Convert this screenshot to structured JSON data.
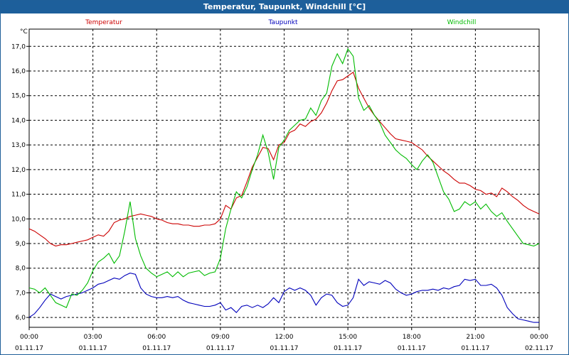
{
  "window": {
    "title": "Temperatur, Taupunkt, Windchill [°C]"
  },
  "chart_data": {
    "type": "line",
    "title": "Temperatur, Taupunkt, Windchill [°C]",
    "ylabel": "°C",
    "ylim": [
      5.6,
      17.7
    ],
    "xlim": [
      "01.11.17 00:00",
      "02.11.17 00:00"
    ],
    "grid": true,
    "legend_placement": "top",
    "y_ticks": [
      "6,0",
      "7,0",
      "8,0",
      "9,0",
      "10,0",
      "11,0",
      "12,0",
      "13,0",
      "14,0",
      "15,0",
      "16,0",
      "17,0"
    ],
    "x_ticks": [
      {
        "time": "00:00",
        "date": "01.11.17"
      },
      {
        "time": "03:00",
        "date": "01.11.17"
      },
      {
        "time": "06:00",
        "date": "01.11.17"
      },
      {
        "time": "09:00",
        "date": "01.11.17"
      },
      {
        "time": "12:00",
        "date": "01.11.17"
      },
      {
        "time": "15:00",
        "date": "01.11.17"
      },
      {
        "time": "18:00",
        "date": "01.11.17"
      },
      {
        "time": "21:00",
        "date": "01.11.17"
      },
      {
        "time": "00:00",
        "date": "02.11.17"
      }
    ],
    "series": [
      {
        "name": "Temperatur",
        "color": "#cc0000",
        "points": [
          [
            0,
            9.6
          ],
          [
            0.25,
            9.5
          ],
          [
            0.5,
            9.35
          ],
          [
            0.75,
            9.2
          ],
          [
            1,
            9.0
          ],
          [
            1.25,
            8.9
          ],
          [
            1.5,
            8.95
          ],
          [
            1.75,
            8.95
          ],
          [
            2,
            9.0
          ],
          [
            2.25,
            9.05
          ],
          [
            2.5,
            9.1
          ],
          [
            2.75,
            9.15
          ],
          [
            3,
            9.25
          ],
          [
            3.25,
            9.35
          ],
          [
            3.5,
            9.3
          ],
          [
            3.75,
            9.5
          ],
          [
            4,
            9.85
          ],
          [
            4.25,
            9.95
          ],
          [
            4.5,
            10.0
          ],
          [
            4.75,
            10.1
          ],
          [
            5,
            10.15
          ],
          [
            5.25,
            10.2
          ],
          [
            5.5,
            10.15
          ],
          [
            5.75,
            10.1
          ],
          [
            6,
            10.0
          ],
          [
            6.25,
            9.95
          ],
          [
            6.5,
            9.85
          ],
          [
            6.75,
            9.8
          ],
          [
            7,
            9.8
          ],
          [
            7.25,
            9.75
          ],
          [
            7.5,
            9.75
          ],
          [
            7.75,
            9.7
          ],
          [
            8,
            9.7
          ],
          [
            8.25,
            9.75
          ],
          [
            8.5,
            9.75
          ],
          [
            8.75,
            9.8
          ],
          [
            9,
            10.0
          ],
          [
            9.25,
            10.55
          ],
          [
            9.5,
            10.4
          ],
          [
            9.75,
            10.85
          ],
          [
            10,
            10.95
          ],
          [
            10.25,
            11.5
          ],
          [
            10.5,
            12.1
          ],
          [
            10.75,
            12.5
          ],
          [
            11,
            12.9
          ],
          [
            11.25,
            12.85
          ],
          [
            11.5,
            12.4
          ],
          [
            11.75,
            13.0
          ],
          [
            12,
            13.1
          ],
          [
            12.25,
            13.5
          ],
          [
            12.5,
            13.6
          ],
          [
            12.75,
            13.85
          ],
          [
            13,
            13.75
          ],
          [
            13.25,
            13.95
          ],
          [
            13.5,
            14.05
          ],
          [
            13.75,
            14.3
          ],
          [
            14,
            14.7
          ],
          [
            14.25,
            15.2
          ],
          [
            14.5,
            15.6
          ],
          [
            14.75,
            15.65
          ],
          [
            15,
            15.8
          ],
          [
            15.25,
            15.95
          ],
          [
            15.5,
            15.3
          ],
          [
            15.75,
            14.9
          ],
          [
            16,
            14.5
          ],
          [
            16.25,
            14.2
          ],
          [
            16.5,
            13.95
          ],
          [
            16.75,
            13.7
          ],
          [
            17,
            13.45
          ],
          [
            17.25,
            13.25
          ],
          [
            17.5,
            13.2
          ],
          [
            17.75,
            13.15
          ],
          [
            18,
            13.1
          ],
          [
            18.25,
            12.95
          ],
          [
            18.5,
            12.8
          ],
          [
            18.75,
            12.55
          ],
          [
            19,
            12.35
          ],
          [
            19.25,
            12.15
          ],
          [
            19.5,
            11.95
          ],
          [
            19.75,
            11.8
          ],
          [
            20,
            11.6
          ],
          [
            20.25,
            11.45
          ],
          [
            20.5,
            11.45
          ],
          [
            20.75,
            11.35
          ],
          [
            21,
            11.2
          ],
          [
            21.25,
            11.15
          ],
          [
            21.5,
            11.0
          ],
          [
            21.75,
            11.05
          ],
          [
            22,
            10.9
          ],
          [
            22.25,
            11.25
          ],
          [
            22.5,
            11.1
          ],
          [
            22.75,
            10.9
          ],
          [
            23,
            10.75
          ],
          [
            23.25,
            10.55
          ],
          [
            23.5,
            10.4
          ],
          [
            23.75,
            10.3
          ],
          [
            24,
            10.2
          ]
        ]
      },
      {
        "name": "Taupunkt",
        "color": "#0000bb",
        "points": [
          [
            0,
            6.0
          ],
          [
            0.25,
            6.15
          ],
          [
            0.5,
            6.4
          ],
          [
            0.75,
            6.7
          ],
          [
            1,
            6.95
          ],
          [
            1.25,
            6.85
          ],
          [
            1.5,
            6.75
          ],
          [
            1.75,
            6.85
          ],
          [
            2,
            6.9
          ],
          [
            2.25,
            6.95
          ],
          [
            2.5,
            7.0
          ],
          [
            2.75,
            7.1
          ],
          [
            3,
            7.2
          ],
          [
            3.25,
            7.35
          ],
          [
            3.5,
            7.4
          ],
          [
            3.75,
            7.5
          ],
          [
            4,
            7.6
          ],
          [
            4.25,
            7.55
          ],
          [
            4.5,
            7.7
          ],
          [
            4.75,
            7.8
          ],
          [
            5,
            7.75
          ],
          [
            5.25,
            7.2
          ],
          [
            5.5,
            6.95
          ],
          [
            5.75,
            6.85
          ],
          [
            6,
            6.8
          ],
          [
            6.25,
            6.8
          ],
          [
            6.5,
            6.85
          ],
          [
            6.75,
            6.8
          ],
          [
            7,
            6.85
          ],
          [
            7.25,
            6.7
          ],
          [
            7.5,
            6.6
          ],
          [
            7.75,
            6.55
          ],
          [
            8,
            6.5
          ],
          [
            8.25,
            6.45
          ],
          [
            8.5,
            6.45
          ],
          [
            8.75,
            6.5
          ],
          [
            9,
            6.6
          ],
          [
            9.25,
            6.3
          ],
          [
            9.5,
            6.4
          ],
          [
            9.75,
            6.2
          ],
          [
            10,
            6.45
          ],
          [
            10.25,
            6.5
          ],
          [
            10.5,
            6.4
          ],
          [
            10.75,
            6.5
          ],
          [
            11,
            6.4
          ],
          [
            11.25,
            6.55
          ],
          [
            11.5,
            6.8
          ],
          [
            11.75,
            6.6
          ],
          [
            12,
            7.05
          ],
          [
            12.25,
            7.2
          ],
          [
            12.5,
            7.1
          ],
          [
            12.75,
            7.2
          ],
          [
            13,
            7.1
          ],
          [
            13.25,
            6.9
          ],
          [
            13.5,
            6.5
          ],
          [
            13.75,
            6.8
          ],
          [
            14,
            6.95
          ],
          [
            14.25,
            6.9
          ],
          [
            14.5,
            6.6
          ],
          [
            14.75,
            6.45
          ],
          [
            15,
            6.5
          ],
          [
            15.25,
            6.8
          ],
          [
            15.5,
            7.55
          ],
          [
            15.75,
            7.3
          ],
          [
            16,
            7.45
          ],
          [
            16.25,
            7.4
          ],
          [
            16.5,
            7.35
          ],
          [
            16.75,
            7.5
          ],
          [
            17,
            7.4
          ],
          [
            17.25,
            7.15
          ],
          [
            17.5,
            7.0
          ],
          [
            17.75,
            6.9
          ],
          [
            18,
            6.95
          ],
          [
            18.25,
            7.05
          ],
          [
            18.5,
            7.1
          ],
          [
            18.75,
            7.1
          ],
          [
            19,
            7.15
          ],
          [
            19.25,
            7.1
          ],
          [
            19.5,
            7.2
          ],
          [
            19.75,
            7.15
          ],
          [
            20,
            7.25
          ],
          [
            20.25,
            7.3
          ],
          [
            20.5,
            7.55
          ],
          [
            20.75,
            7.5
          ],
          [
            21,
            7.55
          ],
          [
            21.25,
            7.3
          ],
          [
            21.5,
            7.3
          ],
          [
            21.75,
            7.35
          ],
          [
            22,
            7.2
          ],
          [
            22.25,
            6.9
          ],
          [
            22.5,
            6.4
          ],
          [
            22.75,
            6.15
          ],
          [
            23,
            5.95
          ],
          [
            23.25,
            5.9
          ],
          [
            23.5,
            5.85
          ],
          [
            23.75,
            5.8
          ],
          [
            24,
            5.8
          ]
        ]
      },
      {
        "name": "Windchill",
        "color": "#00bb00",
        "points": [
          [
            0,
            7.2
          ],
          [
            0.25,
            7.15
          ],
          [
            0.5,
            7.0
          ],
          [
            0.75,
            7.2
          ],
          [
            1,
            6.9
          ],
          [
            1.25,
            6.6
          ],
          [
            1.5,
            6.5
          ],
          [
            1.75,
            6.4
          ],
          [
            2,
            6.95
          ],
          [
            2.25,
            6.9
          ],
          [
            2.5,
            7.1
          ],
          [
            2.75,
            7.4
          ],
          [
            3,
            7.9
          ],
          [
            3.25,
            8.25
          ],
          [
            3.5,
            8.4
          ],
          [
            3.75,
            8.6
          ],
          [
            4,
            8.2
          ],
          [
            4.25,
            8.5
          ],
          [
            4.5,
            9.5
          ],
          [
            4.75,
            10.7
          ],
          [
            5,
            9.2
          ],
          [
            5.25,
            8.5
          ],
          [
            5.5,
            8.0
          ],
          [
            5.75,
            7.8
          ],
          [
            6,
            7.65
          ],
          [
            6.25,
            7.75
          ],
          [
            6.5,
            7.85
          ],
          [
            6.75,
            7.65
          ],
          [
            7,
            7.85
          ],
          [
            7.25,
            7.65
          ],
          [
            7.5,
            7.8
          ],
          [
            7.75,
            7.85
          ],
          [
            8,
            7.9
          ],
          [
            8.25,
            7.7
          ],
          [
            8.5,
            7.8
          ],
          [
            8.75,
            7.85
          ],
          [
            9,
            8.4
          ],
          [
            9.25,
            9.6
          ],
          [
            9.5,
            10.4
          ],
          [
            9.75,
            11.1
          ],
          [
            10,
            10.85
          ],
          [
            10.25,
            11.3
          ],
          [
            10.5,
            12.0
          ],
          [
            10.75,
            12.6
          ],
          [
            11,
            13.4
          ],
          [
            11.25,
            12.7
          ],
          [
            11.5,
            11.6
          ],
          [
            11.75,
            12.9
          ],
          [
            12,
            13.2
          ],
          [
            12.25,
            13.6
          ],
          [
            12.5,
            13.8
          ],
          [
            12.75,
            14.0
          ],
          [
            13,
            14.05
          ],
          [
            13.25,
            14.5
          ],
          [
            13.5,
            14.2
          ],
          [
            13.75,
            14.8
          ],
          [
            14,
            15.1
          ],
          [
            14.25,
            16.2
          ],
          [
            14.5,
            16.7
          ],
          [
            14.75,
            16.3
          ],
          [
            15,
            16.9
          ],
          [
            15.25,
            16.6
          ],
          [
            15.5,
            14.9
          ],
          [
            15.75,
            14.4
          ],
          [
            16,
            14.6
          ],
          [
            16.25,
            14.2
          ],
          [
            16.5,
            13.9
          ],
          [
            16.75,
            13.4
          ],
          [
            17,
            13.1
          ],
          [
            17.25,
            12.8
          ],
          [
            17.5,
            12.6
          ],
          [
            17.75,
            12.45
          ],
          [
            18,
            12.2
          ],
          [
            18.25,
            12.0
          ],
          [
            18.5,
            12.35
          ],
          [
            18.75,
            12.6
          ],
          [
            19,
            12.3
          ],
          [
            19.25,
            11.7
          ],
          [
            19.5,
            11.1
          ],
          [
            19.75,
            10.8
          ],
          [
            20,
            10.3
          ],
          [
            20.25,
            10.4
          ],
          [
            20.5,
            10.7
          ],
          [
            20.75,
            10.55
          ],
          [
            21,
            10.7
          ],
          [
            21.25,
            10.4
          ],
          [
            21.5,
            10.6
          ],
          [
            21.75,
            10.3
          ],
          [
            22,
            10.1
          ],
          [
            22.25,
            10.25
          ],
          [
            22.5,
            9.9
          ],
          [
            22.75,
            9.6
          ],
          [
            23,
            9.3
          ],
          [
            23.25,
            9.0
          ],
          [
            23.5,
            8.95
          ],
          [
            23.75,
            8.9
          ],
          [
            24,
            9.0
          ]
        ]
      }
    ]
  }
}
